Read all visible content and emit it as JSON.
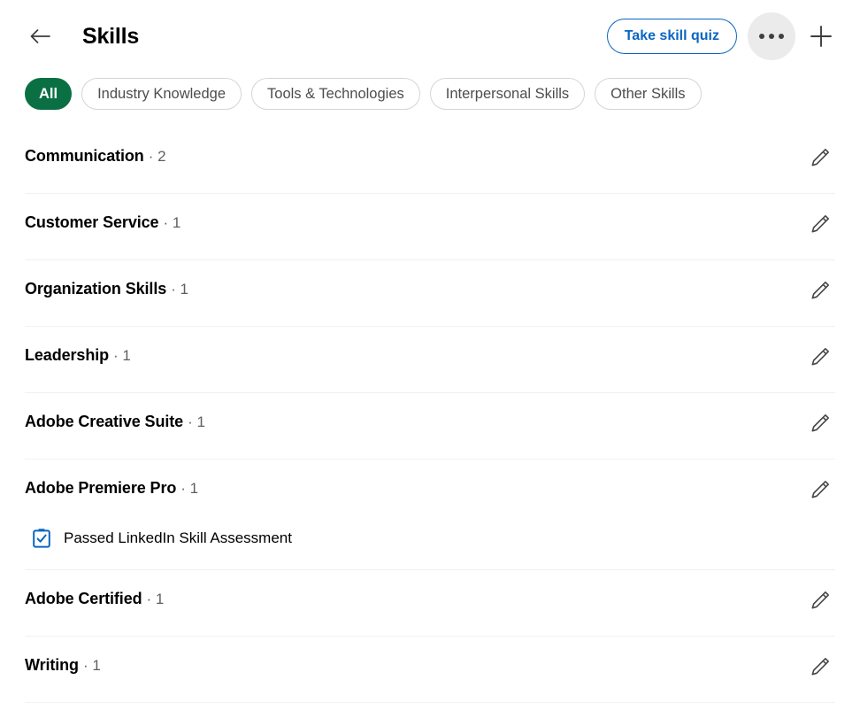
{
  "header": {
    "back_icon": "arrow-left-icon",
    "title": "Skills",
    "quiz_button_label": "Take skill quiz",
    "more_icon": "overflow-menu-icon",
    "add_icon": "plus-icon",
    "accent_blue": "#0a66c2",
    "more_bg": "#ebebeb"
  },
  "filters": {
    "selected_color": "#0a7044",
    "chips": [
      {
        "label": "All",
        "selected": true
      },
      {
        "label": "Industry Knowledge",
        "selected": false
      },
      {
        "label": "Tools & Technologies",
        "selected": false
      },
      {
        "label": "Interpersonal Skills",
        "selected": false
      },
      {
        "label": "Other Skills",
        "selected": false
      }
    ]
  },
  "skills": [
    {
      "name": "Communication",
      "count": "· 2",
      "edit_icon": "pencil-icon",
      "assessment": null
    },
    {
      "name": "Customer Service",
      "count": "· 1",
      "edit_icon": "pencil-icon",
      "assessment": null
    },
    {
      "name": "Organization Skills",
      "count": "· 1",
      "edit_icon": "pencil-icon",
      "assessment": null
    },
    {
      "name": "Leadership",
      "count": "· 1",
      "edit_icon": "pencil-icon",
      "assessment": null
    },
    {
      "name": "Adobe Creative Suite",
      "count": "· 1",
      "edit_icon": "pencil-icon",
      "assessment": null
    },
    {
      "name": "Adobe Premiere Pro",
      "count": "· 1",
      "edit_icon": "pencil-icon",
      "assessment": {
        "label": "Passed LinkedIn Skill Assessment",
        "icon": "skill-assessment-badge-icon",
        "icon_color": "#0a66c2"
      }
    },
    {
      "name": "Adobe Certified",
      "count": "· 1",
      "edit_icon": "pencil-icon",
      "assessment": null
    },
    {
      "name": "Writing",
      "count": "· 1",
      "edit_icon": "pencil-icon",
      "assessment": null
    }
  ]
}
